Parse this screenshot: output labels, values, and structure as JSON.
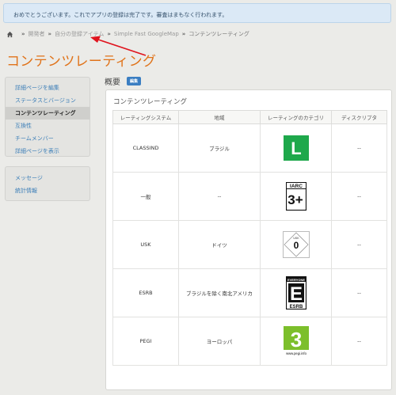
{
  "notice": "おめでとうございます。これでアプリの登録は完了です。審査はまもなく行われます。",
  "breadcrumb": {
    "items": [
      "開発者",
      "自分の登録アイテム",
      "Simple Fast GoogleMap",
      "コンテンツレーティング"
    ],
    "separator": "»"
  },
  "page_title": "コンテンツレーティング",
  "sidebar": {
    "primary": [
      "詳細ページを編集",
      "ステータスとバージョン",
      "コンテンツレーティング",
      "互換性",
      "チームメンバー",
      "詳細ページを表示"
    ],
    "active_index": 2,
    "secondary": [
      "メッセージ",
      "統計情報"
    ]
  },
  "section": {
    "heading": "概要",
    "edit_label": "編集"
  },
  "panel": {
    "title": "コンテンツレーティング",
    "columns": [
      "レーティングシステム",
      "地域",
      "レーティングのカテゴリ",
      "ディスクリプタ"
    ],
    "rows": [
      {
        "system": "CLASSIND",
        "region": "ブラジル",
        "icon": "classind-l-icon",
        "icon_text": "L",
        "descriptor": "--"
      },
      {
        "system": "一般",
        "region": "--",
        "icon": "iarc-3-icon",
        "icon_text": "3+",
        "icon_header": "IARC",
        "descriptor": "--"
      },
      {
        "system": "USK",
        "region": "ドイツ",
        "icon": "usk-0-icon",
        "icon_text": "0",
        "icon_header": "USK",
        "descriptor": "--"
      },
      {
        "system": "ESRB",
        "region": "ブラジルを除く南北アメリカ",
        "icon": "esrb-e-icon",
        "icon_text": "E",
        "icon_header": "EVERYONE",
        "icon_footer": "ESRB",
        "descriptor": "--"
      },
      {
        "system": "PEGI",
        "region": "ヨーロッパ",
        "icon": "pegi-3-icon",
        "icon_text": "3",
        "icon_footer": "www.pegi.info",
        "descriptor": "--"
      }
    ]
  },
  "colors": {
    "accent": "#e0731a",
    "link": "#3d7fb8",
    "classind_green": "#1ea84b",
    "pegi_green": "#7cbf2b"
  }
}
